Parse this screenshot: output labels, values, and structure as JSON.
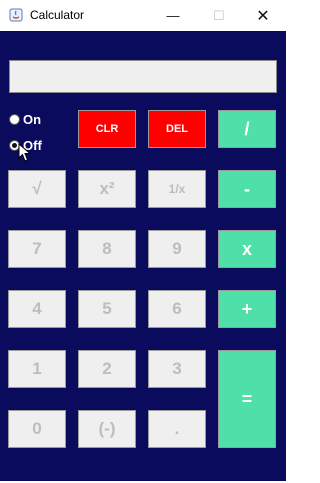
{
  "window": {
    "title": "Calculator",
    "controls": {
      "minimize": "—",
      "maximize": "☐",
      "close": "✕"
    }
  },
  "display": {
    "value": ""
  },
  "power": {
    "on_label": "On",
    "off_label": "Off",
    "selected": "Off"
  },
  "keys": {
    "clr": "CLR",
    "del": "DEL",
    "divide": "/",
    "sqrt": "√",
    "square": "x²",
    "reciprocal": "1/x",
    "minus": "-",
    "seven": "7",
    "eight": "8",
    "nine": "9",
    "multiply": "x",
    "four": "4",
    "five": "5",
    "six": "6",
    "plus": "+",
    "one": "1",
    "two": "2",
    "three": "3",
    "equals": "=",
    "zero": "0",
    "negate": "(-)",
    "decimal": "."
  },
  "colors": {
    "background": "#0b0b5e",
    "accent_red": "#ff0000",
    "accent_teal": "#4ee0a8",
    "key_gray": "#efefef"
  }
}
